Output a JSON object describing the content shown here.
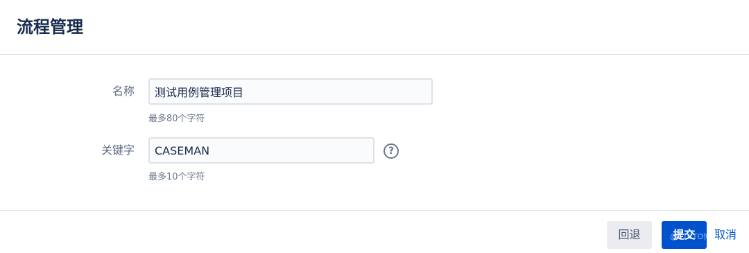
{
  "header": {
    "title": "流程管理"
  },
  "form": {
    "name": {
      "label": "名称",
      "value": "测试用例管理项目",
      "hint": "最多80个字符"
    },
    "key": {
      "label": "关键字",
      "value": "CASEMAN",
      "hint": "最多10个字符",
      "help_icon": "question-mark"
    }
  },
  "footer": {
    "back_label": "回退",
    "submit_label": "提交",
    "cancel_label": "取消"
  },
  "watermark": "@51CTO博客",
  "colors": {
    "primary": "#0052cc",
    "text": "#172b4d",
    "muted": "#6b778c",
    "border": "#dfe1e6"
  }
}
